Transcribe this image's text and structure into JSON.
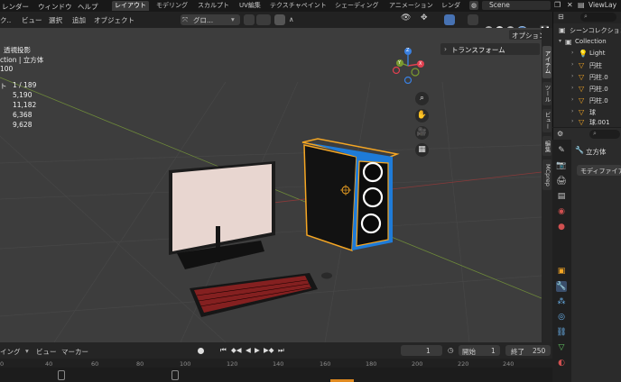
{
  "topbar": {
    "menus": [
      "レンダー",
      "ウィンドウ",
      "ヘルプ"
    ],
    "workspace_tabs": [
      "レイアウト",
      "モデリング",
      "スカルプト",
      "UV編集",
      "テクスチャペイント",
      "シェーディング",
      "アニメーション",
      "レンダ"
    ],
    "active_tab": "レイアウト",
    "scene_name": "Scene",
    "view_layer": "ViewLay"
  },
  "viewport_header": {
    "mode_partial": "ク..",
    "menus": [
      "ビュー",
      "選択",
      "追加",
      "オブジェクト"
    ],
    "orientation": "グロ...",
    "options_label": "オプション"
  },
  "viewport_overlay": {
    "line1": "透視投影",
    "line2": "ction | 立方体",
    "line3": "100",
    "stats": [
      {
        "label": "ト",
        "value": "1 / 189"
      },
      {
        "label": "",
        "value": "5,190"
      },
      {
        "label": "",
        "value": "11,182"
      },
      {
        "label": "",
        "value": "6,368"
      },
      {
        "label": "",
        "value": "9,628"
      }
    ],
    "transform_panel": "トランスフォーム"
  },
  "gizmo": {
    "x": "X",
    "y": "Y",
    "z": "Z"
  },
  "npanel_tabs": [
    "アイテム",
    "ツール",
    "ビュー",
    "編集",
    "MCprep"
  ],
  "outliner": {
    "header": "シーンコレクション",
    "collection": "Collection",
    "items": [
      "Light",
      "円柱",
      "円柱.0",
      "円柱.0",
      "円柱.0",
      "球",
      "球.001"
    ]
  },
  "properties": {
    "search_placeholder": "",
    "object_name": "立方体",
    "modifier_label": "モディファイア"
  },
  "timeline": {
    "playback_partial": "イング",
    "view_label": "ビュー",
    "marker_label": "マーカー",
    "current_frame": "1",
    "start_label": "開始",
    "start_value": "1",
    "end_label": "終了",
    "end_value": "250",
    "ruler": [
      "0",
      "40",
      "60",
      "80",
      "100",
      "120",
      "140",
      "160",
      "180",
      "200",
      "220",
      "240"
    ]
  },
  "colors": {
    "selection_orange": "#f5a623",
    "case_blue": "#1e7bd8",
    "keyboard_red": "#e02a2a",
    "active_tab_bg": "#3a3a3a"
  }
}
